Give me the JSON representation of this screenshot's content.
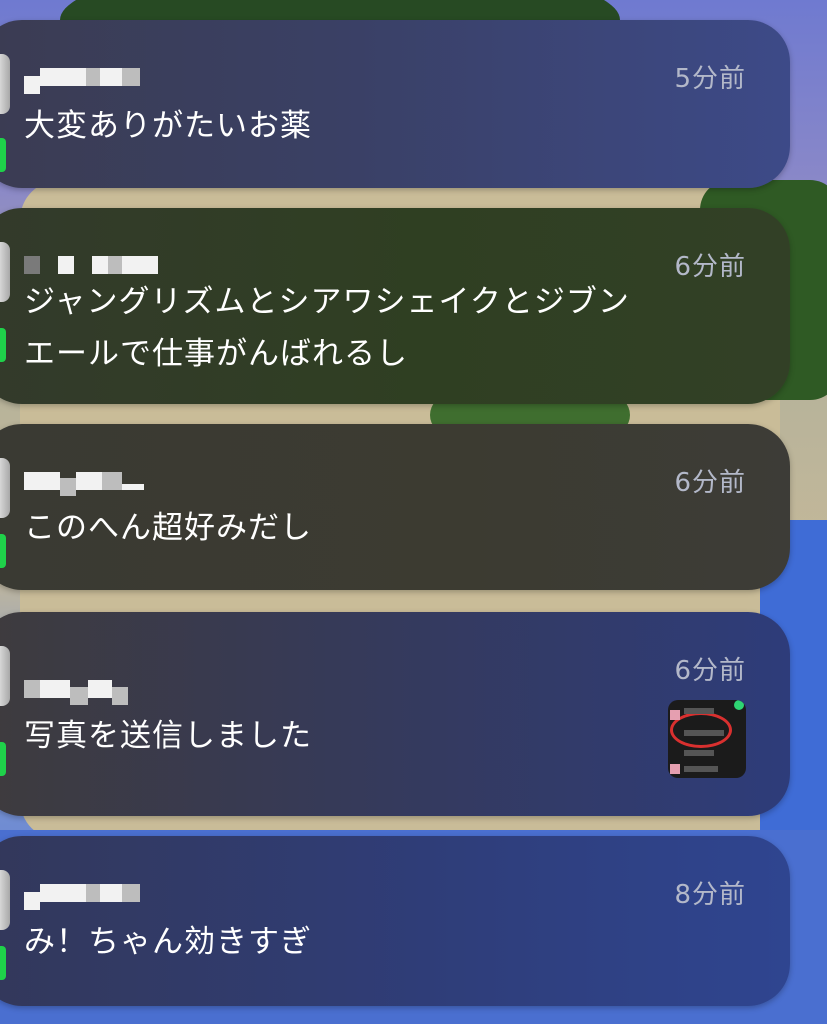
{
  "notifications": [
    {
      "time": "5分前",
      "message": "大変ありがたいお薬",
      "has_thumbnail": false,
      "bg": "linear-gradient(90deg,#3b3c52 0%,#3a4065 45%,#3d4a88 100%)"
    },
    {
      "time": "6分前",
      "message": "ジャングリズムとシアワシェイクとジブン\nエールで仕事がんばれるし",
      "has_thumbnail": false,
      "bg": "linear-gradient(90deg,#333a2b 0%,#2f3f22 55%,#324026 100%)"
    },
    {
      "time": "6分前",
      "message": "このへん超好みだし",
      "has_thumbnail": false,
      "bg": "linear-gradient(90deg,#3a3a33 0%,#3c3b31 60%,#3d3c37 100%)"
    },
    {
      "time": "6分前",
      "message": "写真を送信しました",
      "has_thumbnail": true,
      "bg": "linear-gradient(90deg,#3e3b3d 0%,#353a5c 50%,#2e3c7a 100%)"
    },
    {
      "time": "8分前",
      "message": "み！ちゃん効きすぎ",
      "has_thumbnail": false,
      "bg": "linear-gradient(90deg,#33385a 0%,#2f3d78 55%,#2f4590 100%)"
    }
  ],
  "colors": {
    "message_text": "#ffffff",
    "time_text": "#b3b8c9",
    "status_dot": "#1fd14a"
  },
  "icons": [
    "app-icon",
    "photo-thumbnail"
  ]
}
